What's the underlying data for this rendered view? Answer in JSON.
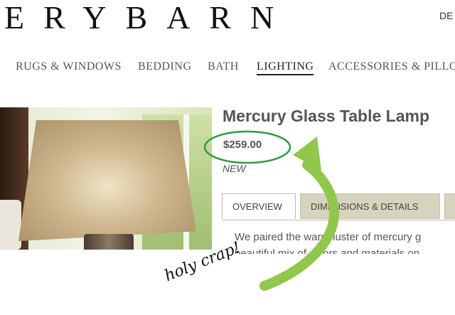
{
  "header": {
    "logo_text": "ERYBARN",
    "corner_link": "DE"
  },
  "nav": {
    "items": [
      {
        "label": "RUGS & WINDOWS",
        "active": false
      },
      {
        "label": "BEDDING",
        "active": false
      },
      {
        "label": "BATH",
        "active": false
      },
      {
        "label": "LIGHTING",
        "active": true
      },
      {
        "label": "ACCESSORIES & PILLOWS",
        "active": false
      }
    ]
  },
  "product": {
    "title": "Mercury Glass Table Lamp",
    "price": "$259.00",
    "badge": "NEW",
    "image_alt": "lamp with burlap shade"
  },
  "tabs": [
    {
      "label": "OVERVIEW",
      "active": true
    },
    {
      "label": "DIMENSIONS & DETAILS",
      "active": false
    },
    {
      "label": "",
      "active": false
    }
  ],
  "description": {
    "line1": "We paired the warm luster of mercury g",
    "line2": "beautiful mix of colors and materials on"
  },
  "annotation": {
    "handwriting": "holy crap!",
    "circle_color": "#2e9e3c",
    "arrow_color": "#8fc84a"
  }
}
